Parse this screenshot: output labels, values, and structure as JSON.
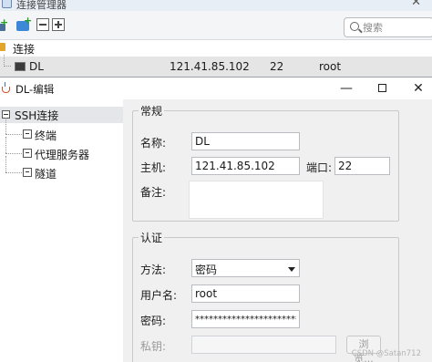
{
  "manager": {
    "title": "连接管理器",
    "search_placeholder": "搜索",
    "group_label": "连接",
    "connection": {
      "name": "DL",
      "host": "121.41.85.102",
      "port": "22",
      "user": "root"
    }
  },
  "dialog": {
    "title": "DL-编辑",
    "window_buttons": {
      "minimize": "—",
      "close": "✕"
    },
    "nav": {
      "root": "SSH连接",
      "items": [
        "终端",
        "代理服务器",
        "隧道"
      ]
    },
    "general": {
      "legend": "常规",
      "name_label": "名称:",
      "name_value": "DL",
      "host_label": "主机:",
      "host_value": "121.41.85.102",
      "port_label": "端口:",
      "port_value": "22",
      "note_label": "备注:",
      "note_value": ""
    },
    "auth": {
      "legend": "认证",
      "method_label": "方法:",
      "method_value": "密码",
      "user_label": "用户名:",
      "user_value": "root",
      "password_label": "密码:",
      "password_value": "************************",
      "key_label": "私钥:",
      "key_value": "",
      "browse_label": "浏览..."
    }
  },
  "watermark": "CSDN @Satan712"
}
